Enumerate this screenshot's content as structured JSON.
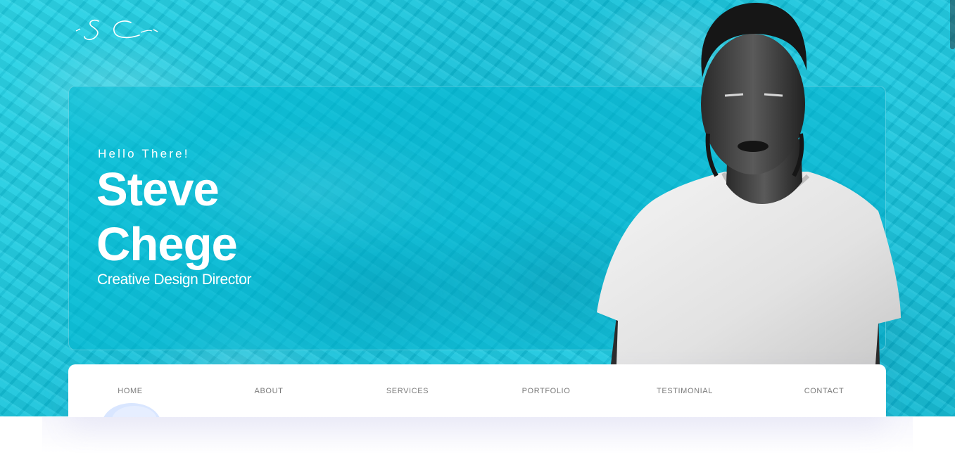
{
  "logo": {
    "text": "SC"
  },
  "hero": {
    "greeting": "Hello There!",
    "first_name": "Steve",
    "last_name": "Chege",
    "role": "Creative Design Director",
    "background_color": "#14c6df"
  },
  "nav": {
    "items": [
      {
        "label": "HOME"
      },
      {
        "label": "ABOUT"
      },
      {
        "label": "SERVICES"
      },
      {
        "label": "PORTFOLIO"
      },
      {
        "label": "TESTIMONIAL"
      },
      {
        "label": "CONTACT"
      }
    ]
  }
}
